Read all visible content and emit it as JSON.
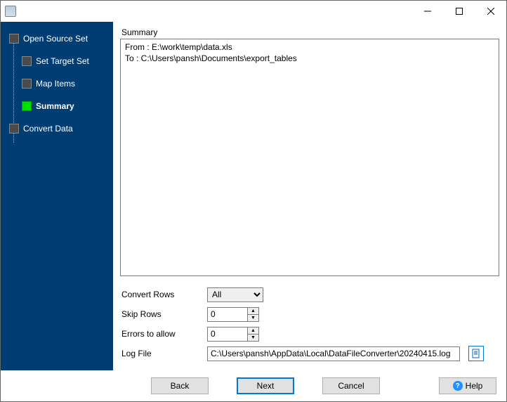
{
  "window": {
    "title": ""
  },
  "sidebar": {
    "items": [
      {
        "label": "Open Source Set"
      },
      {
        "label": "Set Target Set"
      },
      {
        "label": "Map Items"
      },
      {
        "label": "Summary"
      },
      {
        "label": "Convert Data"
      }
    ]
  },
  "main": {
    "section_label": "Summary",
    "summary_text": "From : E:\\work\\temp\\data.xls\nTo : C:\\Users\\pansh\\Documents\\export_tables",
    "rows": {
      "convert_rows_label": "Convert Rows",
      "convert_rows_value": "All",
      "convert_rows_options": [
        "All"
      ],
      "skip_rows_label": "Skip Rows",
      "skip_rows_value": "0",
      "errors_label": "Errors to allow",
      "errors_value": "0",
      "logfile_label": "Log File",
      "logfile_value": "C:\\Users\\pansh\\AppData\\Local\\DataFileConverter\\20240415.log"
    }
  },
  "buttons": {
    "back": "Back",
    "next": "Next",
    "cancel": "Cancel",
    "help": "Help"
  }
}
